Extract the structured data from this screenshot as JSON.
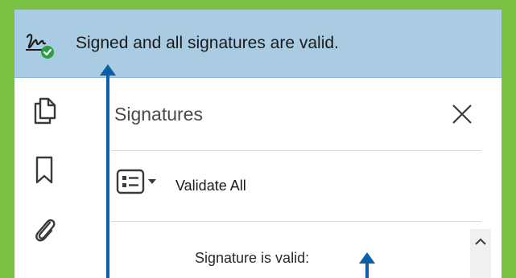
{
  "banner": {
    "message": "Signed and all signatures are valid.",
    "icon": "signature-valid-icon",
    "accent": "#a9cce3"
  },
  "rail": {
    "icons": [
      "pages-icon",
      "bookmark-icon",
      "attachment-icon"
    ]
  },
  "panel": {
    "title": "Signatures",
    "validate_all_label": "Validate All",
    "status_text": "Signature is valid:"
  },
  "colors": {
    "background_border": "#7ac143",
    "annotation_arrow": "#0b5ea8",
    "check_badge": "#2e9e44"
  }
}
